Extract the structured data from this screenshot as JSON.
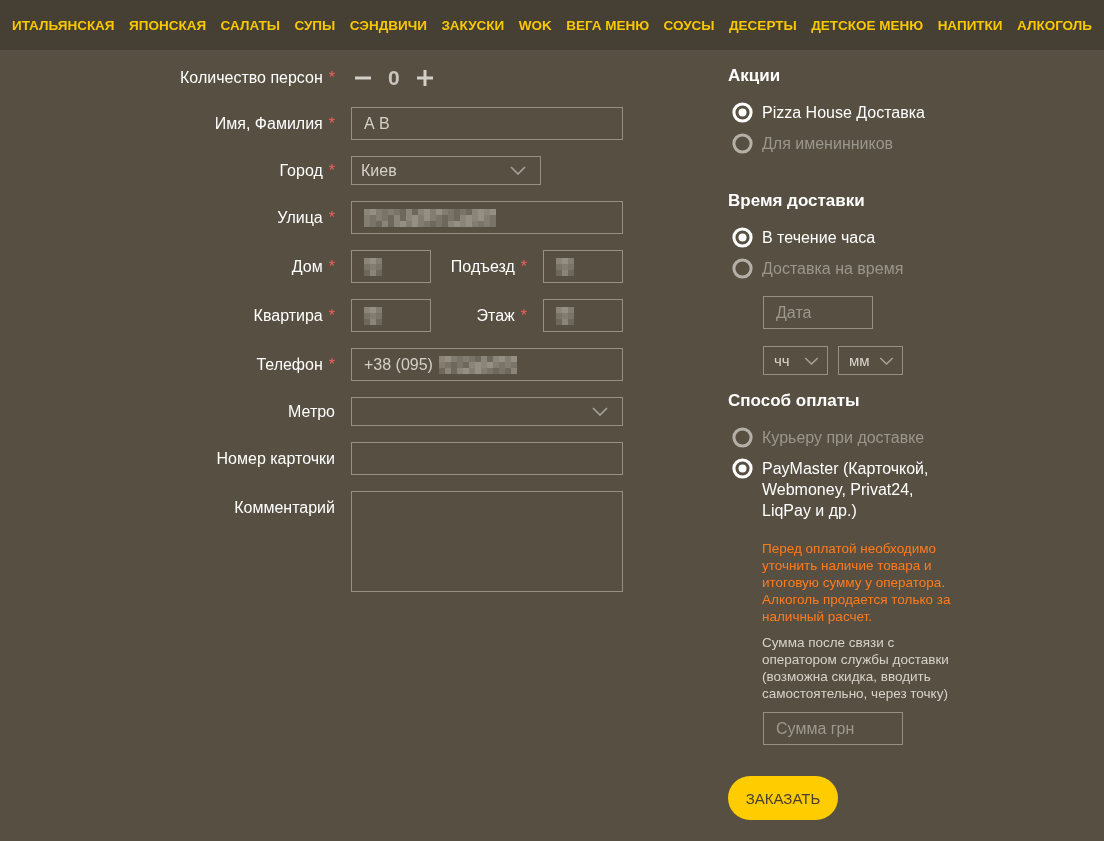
{
  "nav": [
    {
      "label": "ИТАЛЬЯНСКАЯ"
    },
    {
      "label": "ЯПОНСКАЯ"
    },
    {
      "label": "САЛАТЫ"
    },
    {
      "label": "СУПЫ"
    },
    {
      "label": "СЭНДВИЧИ"
    },
    {
      "label": "ЗАКУСКИ"
    },
    {
      "label": "WOK"
    },
    {
      "label": "ВЕГА МЕНЮ"
    },
    {
      "label": "СОУСЫ"
    },
    {
      "label": "ДЕСЕРТЫ"
    },
    {
      "label": "ДЕТСКОЕ МЕНЮ"
    },
    {
      "label": "НАПИТКИ"
    },
    {
      "label": "АЛКОГОЛЬ"
    }
  ],
  "form": {
    "required_mark": "*",
    "persons": {
      "label": "Количество персон",
      "required": true,
      "value": "0"
    },
    "rows": [
      {
        "kind": "text",
        "label": "Имя, Фамилия",
        "required": true,
        "value": "А В",
        "redacted": false
      },
      {
        "kind": "select",
        "label": "Город",
        "required": true,
        "value": "Киев"
      },
      {
        "kind": "text",
        "label": "Улица",
        "required": true,
        "redacted": true
      },
      {
        "kind": "pair",
        "fields": [
          {
            "label": "Дом",
            "required": true,
            "redacted": true
          },
          {
            "label": "Подъезд",
            "required": true,
            "redacted": true
          }
        ]
      },
      {
        "kind": "pair",
        "fields": [
          {
            "label": "Квартира",
            "required": true,
            "redacted": true
          },
          {
            "label": "Этаж",
            "required": true,
            "redacted": true
          }
        ]
      },
      {
        "kind": "text",
        "label": "Телефон",
        "required": true,
        "value": "+38 (095)",
        "redacted": true
      },
      {
        "kind": "select",
        "label": "Метро",
        "required": false
      },
      {
        "kind": "text",
        "label": "Номер карточки",
        "required": false,
        "redacted": false
      },
      {
        "kind": "textarea",
        "label": "Комментарий",
        "required": false
      }
    ]
  },
  "promotions": {
    "title": "Акции",
    "options": [
      {
        "label": "Pizza House Доставка",
        "selected": true
      },
      {
        "label": "Для именинников",
        "selected": false
      }
    ]
  },
  "delivery_time": {
    "title": "Время доставки",
    "options": [
      {
        "label": "В течение часа",
        "selected": true
      },
      {
        "label": "Доставка на время",
        "selected": false
      }
    ],
    "date": {
      "placeholder": "Дата"
    },
    "hour": {
      "value": "чч"
    },
    "minute": {
      "value": "мм"
    }
  },
  "payment": {
    "title": "Способ оплаты",
    "options": [
      {
        "label": "Курьеру при доставке",
        "selected": false
      },
      {
        "label": "PayMaster (Карточкой,\nWebmoney, Privat24,\nLiqPay и др.)",
        "selected": true
      }
    ],
    "warning": "Перед оплатой необходимо\nуточнить наличие товара и\nитоговую сумму у оператора.\nАлкоголь продается только за\nналичный расчет.",
    "note": "Сумма после связи с\nоператором службы доставки\n(возможна скидка, вводить\nсамостоятельно, через точку)",
    "amount": {
      "placeholder": "Сумма грн"
    }
  },
  "submit": {
    "label": "ЗАКАЗАТЬ"
  }
}
